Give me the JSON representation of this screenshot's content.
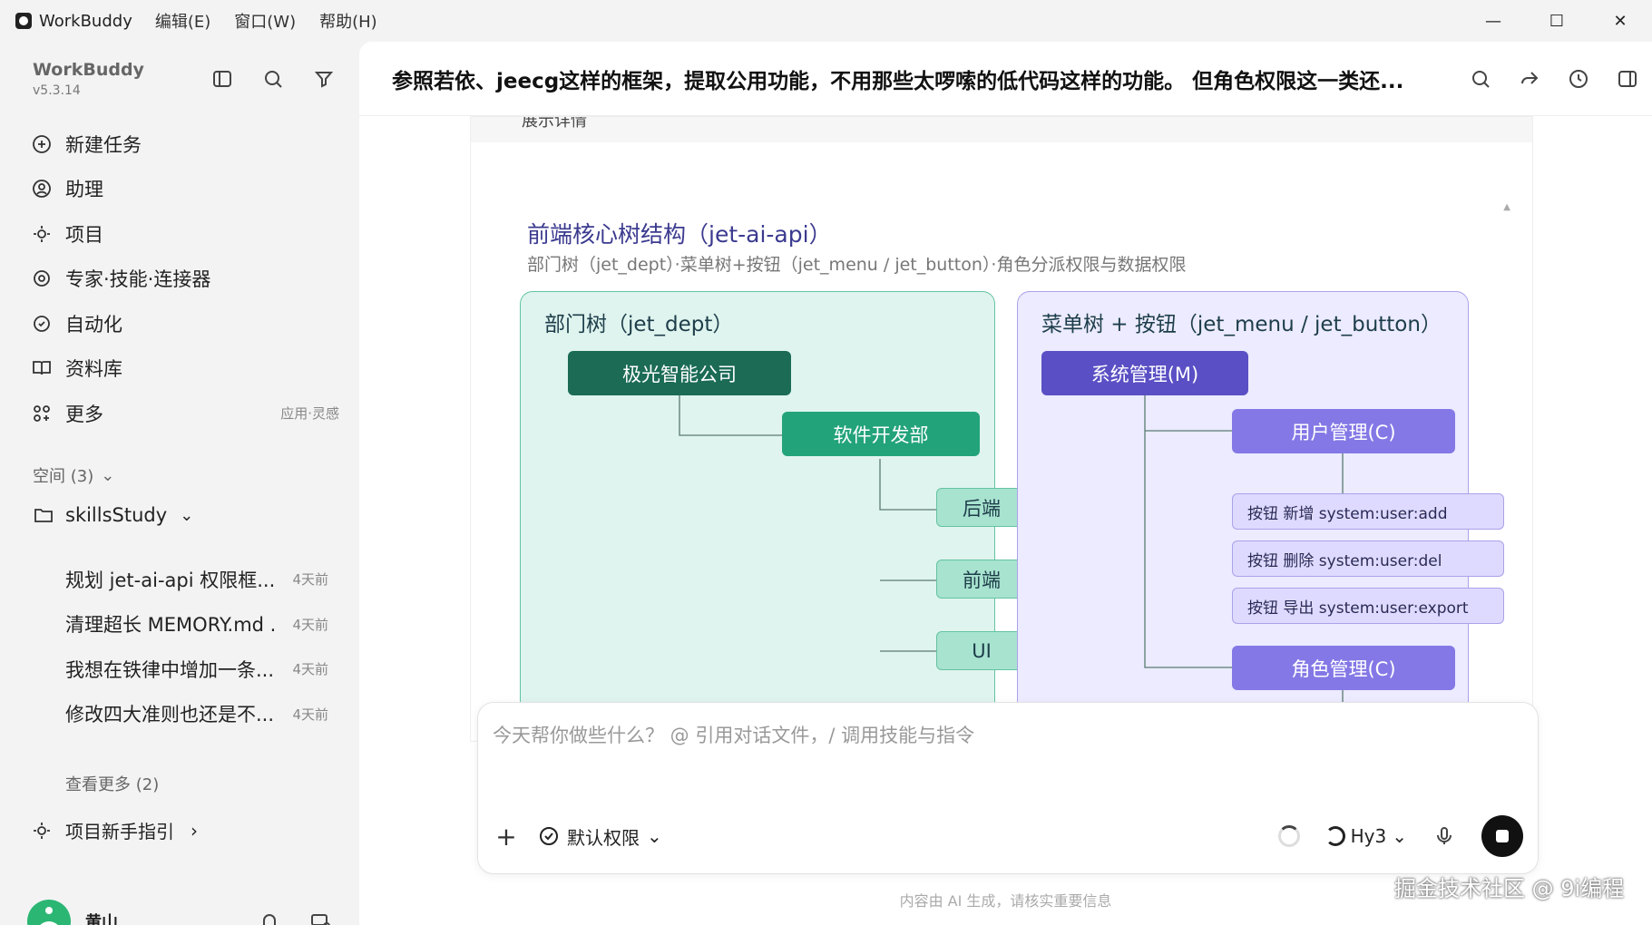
{
  "titlebar": {
    "app_name": "WorkBuddy",
    "menus": [
      "编辑(E)",
      "窗口(W)",
      "帮助(H)"
    ],
    "controls": [
      "minimize-icon",
      "maximize-icon",
      "close-icon"
    ]
  },
  "sidebar": {
    "brand": "WorkBuddy",
    "version": "v5.3.14",
    "nav": [
      {
        "label": "新建任务",
        "icon": "plus-circle-icon"
      },
      {
        "label": "助理",
        "icon": "assistant-icon"
      },
      {
        "label": "项目",
        "icon": "project-icon"
      },
      {
        "label": "专家·技能·连接器",
        "icon": "expert-icon"
      },
      {
        "label": "自动化",
        "icon": "automation-icon"
      },
      {
        "label": "资料库",
        "icon": "book-icon"
      },
      {
        "label": "更多",
        "icon": "more-icon",
        "hint": "应用·灵感"
      }
    ],
    "space_label": "空间 (3)",
    "folder": "skillsStudy",
    "tasks": [
      {
        "title": "规划 jet-ai-api 权限框...",
        "ago": "4天前"
      },
      {
        "title": "清理超长 MEMORY.md ...",
        "ago": "4天前"
      },
      {
        "title": "我想在铁律中增加一条...",
        "ago": "4天前"
      },
      {
        "title": "修改四大准则也还是不...",
        "ago": "4天前"
      }
    ],
    "see_more": "查看更多 (2)",
    "guide": "项目新手指引",
    "user_name": "黄山"
  },
  "main": {
    "title": "参照若依、jeecg这样的框架，提取公用功能，不用那些太啰嗦的低代码这样的功能。 但角色权限这一类还...",
    "collapsed_label": "展示详情",
    "diagram": {
      "title": "前端核心树结构（jet-ai-api）",
      "subtitle": "部门树（jet_dept）·菜单树+按钮（jet_menu / jet_button）·角色分派权限与数据权限",
      "dept_panel": {
        "title": "部门树（jet_dept）",
        "root": "极光智能公司",
        "child": "软件开发部",
        "leaves": [
          "后端",
          "前端",
          "UI"
        ]
      },
      "menu_panel": {
        "title": "菜单树 + 按钮（jet_menu / jet_button）",
        "root": "系统管理(M)",
        "user_mgmt": "用户管理(C)",
        "buttons": [
          "按钮 新增 system:user:add",
          "按钮 删除 system:user:del",
          "按钮 导出 system:user:export"
        ],
        "role_mgmt": "角色管理(C)"
      }
    },
    "composer": {
      "placeholder": "今天帮你做些什么？ @ 引用对话文件，/ 调用技能与指令",
      "permission": "默认权限",
      "model": "Hy3"
    },
    "disclaimer": "内容由 AI 生成，请核实重要信息"
  },
  "watermark": "掘金技术社区 @ 9i编程",
  "colors": {
    "dept_dark": "#1b6b55",
    "dept_mid": "#23a37a",
    "dept_light": "#a8e3cf",
    "menu_dark": "#5a4fc4",
    "menu_mid": "#8478e6",
    "menu_light": "#dedaff"
  }
}
